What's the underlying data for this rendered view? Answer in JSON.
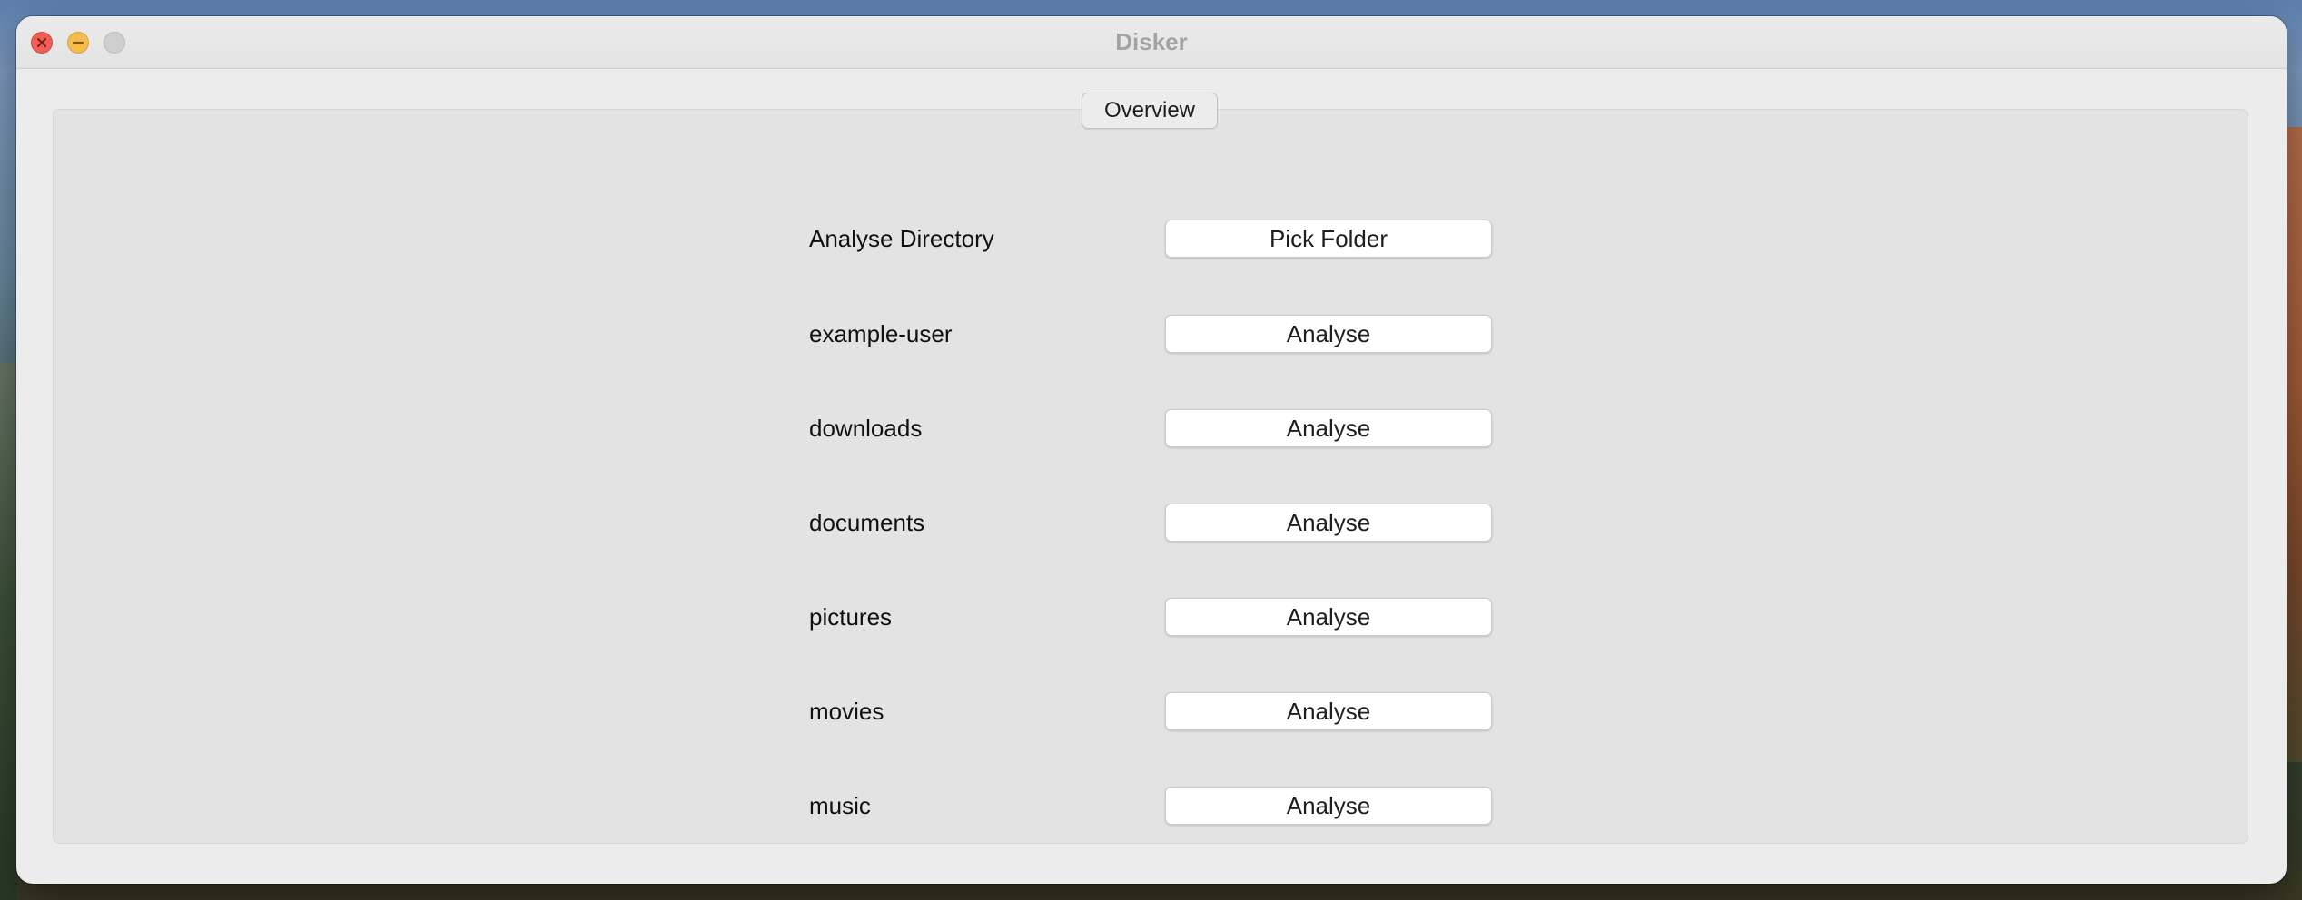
{
  "window": {
    "title": "Disker"
  },
  "tabs": {
    "overview_label": "Overview"
  },
  "pick_row": {
    "label": "Analyse Directory",
    "button_label": "Pick Folder"
  },
  "folders": [
    {
      "label": "example-user",
      "button_label": "Analyse"
    },
    {
      "label": "downloads",
      "button_label": "Analyse"
    },
    {
      "label": "documents",
      "button_label": "Analyse"
    },
    {
      "label": "pictures",
      "button_label": "Analyse"
    },
    {
      "label": "movies",
      "button_label": "Analyse"
    },
    {
      "label": "music",
      "button_label": "Analyse"
    }
  ],
  "colors": {
    "close": "#ee5f57",
    "minimize": "#f5bd4f",
    "zoom_inactive": "#cfcfcf"
  }
}
